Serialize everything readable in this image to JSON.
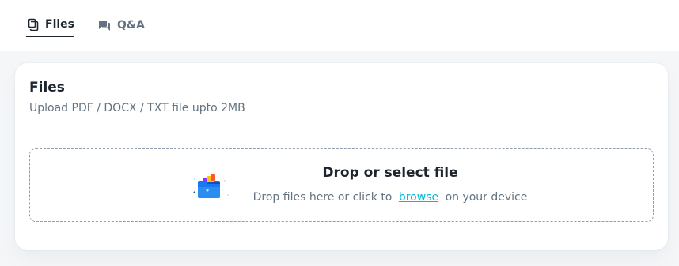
{
  "tabs": [
    {
      "label": "Files",
      "icon": "files-icon",
      "active": true
    },
    {
      "label": "Q&A",
      "icon": "chat-icon",
      "active": false
    }
  ],
  "card": {
    "title": "Files",
    "subtitle": "Upload PDF / DOCX / TXT file upto 2MB"
  },
  "dropzone": {
    "title": "Drop or select file",
    "desc_prefix": "Drop files here or click to",
    "link": "browse",
    "desc_suffix": "on your device",
    "illustration": "upload-folder-illustration"
  },
  "colors": {
    "page_bg": "#f4f6f8",
    "text_primary": "#1c252e",
    "text_secondary": "#637381",
    "link": "#00b8d9",
    "dashed_border": "#919eab"
  }
}
